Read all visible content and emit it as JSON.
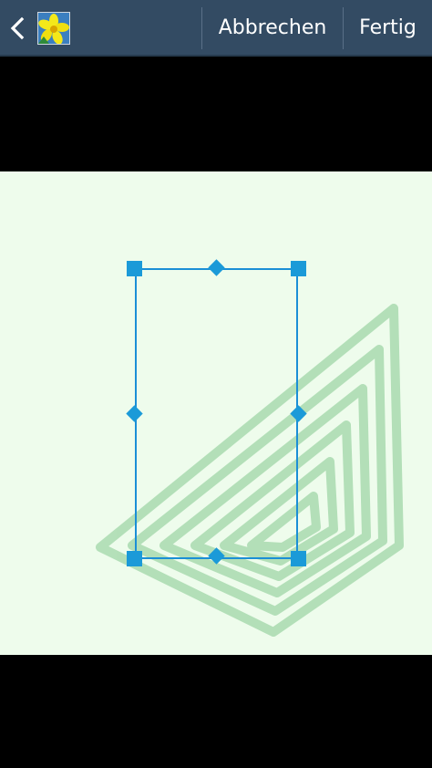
{
  "action_bar": {
    "back_icon": "chevron-left-icon",
    "app_icon": "gallery-flower-icon",
    "cancel_label": "Abbrechen",
    "done_label": "Fertig"
  },
  "colors": {
    "action_bar_bg": "#334b63",
    "image_bg": "#eefcec",
    "crop_accent": "#1b9ad8",
    "art_green": "#8fcf98"
  }
}
